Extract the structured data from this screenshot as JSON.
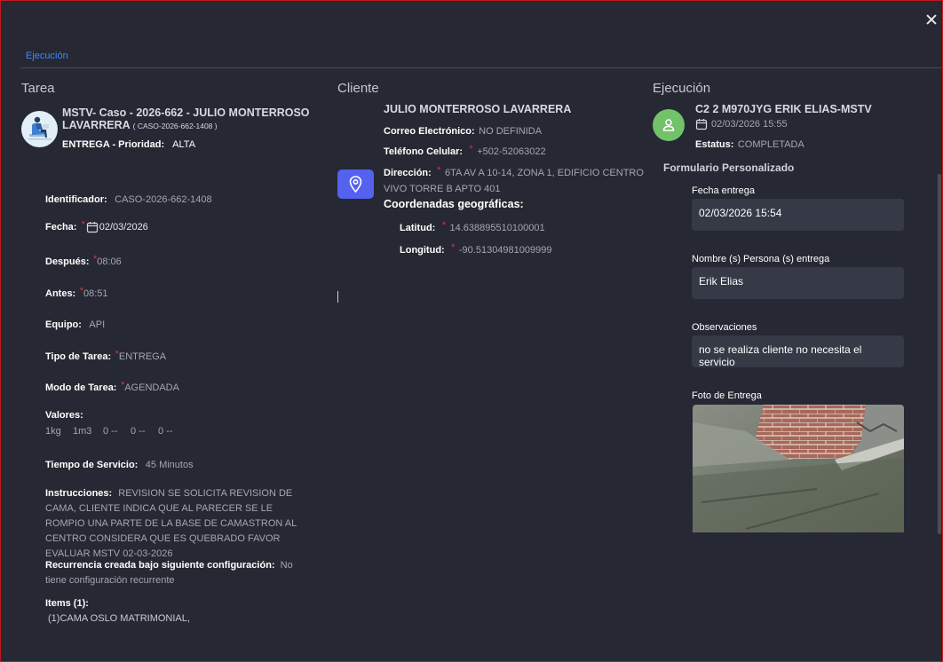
{
  "tab": "Ejecución",
  "columns": {
    "tarea": "Tarea",
    "cliente": "Cliente",
    "ejecucion": "Ejecución"
  },
  "tarea": {
    "title": "MSTV- Caso - 2026-662 - JULIO MONTERROSO LAVARRERA",
    "code": "( CASO-2026-662-1408 )",
    "subtitle_type": "ENTREGA",
    "subtitle_prioridad_label": "- Prioridad:",
    "subtitle_prioridad": "ALTA",
    "identificador_label": "Identificador:",
    "identificador": "CASO-2026-662-1408",
    "fecha_label": "Fecha:",
    "fecha": "02/03/2026",
    "despues_label": "Después:",
    "despues": "08:06",
    "antes_label": "Antes:",
    "antes": "08:51",
    "equipo_label": "Equipo:",
    "equipo": "API",
    "tipo_label": "Tipo de Tarea:",
    "tipo": "ENTREGA",
    "modo_label": "Modo de Tarea:",
    "modo": "AGENDADA",
    "valores_label": "Valores:",
    "valores": [
      "1kg",
      "1m3",
      "0 --",
      "0 --",
      "0 --"
    ],
    "tiempo_label": "Tiempo de Servicio:",
    "tiempo": "45 Minutos",
    "instrucciones_label": "Instrucciones:",
    "instrucciones": "REVISION SE SOLICITA REVISION DE CAMA, CLIENTE INDICA QUE AL PARECER SE LE ROMPIO UNA PARTE DE LA BASE DE CAMASTRON AL CENTRO CONSIDERA QUE ES QUEBRADO FAVOR EVALUAR MSTV 02-03-2026",
    "recurrencia_label": "Recurrencia creada bajo siguiente configuración:",
    "recurrencia": "No tiene configuración recurrente",
    "items_label": "Items (1):",
    "items": "(1)CAMA OSLO MATRIMONIAL,"
  },
  "cliente": {
    "name": "JULIO MONTERROSO LAVARRERA",
    "correo_label": "Correo Electrónico:",
    "correo": "NO DEFINIDA",
    "telefono_label": "Teléfono Celular:",
    "telefono": "+502-52063022",
    "direccion_label": "Dirección:",
    "direccion_1": "6TA AV A 10-14, ZONA 1, EDIFICIO CENTRO",
    "direccion_2": "VIVO TORRE B APTO 401",
    "coords_label": "Coordenadas geográficas:",
    "latitud_label": "Latitud:",
    "latitud": "14.638895510100001",
    "longitud_label": "Longitud:",
    "longitud": "-90.51304981009999"
  },
  "ejecucion": {
    "name": "C2 2 M970JYG ERIK ELIAS-MSTV",
    "datetime": "02/03/2026 15:55",
    "estatus_label": "Estatus:",
    "estatus": "COMPLETADA",
    "form_title": "Formulario Personalizado",
    "fields": [
      {
        "label": "Fecha entrega",
        "value": "02/03/2026 15:54"
      },
      {
        "label": "Nombre (s) Persona (s) entrega",
        "value": "Erik Elias"
      },
      {
        "label": "Observaciones",
        "value": "no se realiza cliente no necesita el servicio"
      }
    ],
    "photo_label": "Foto de Entrega"
  },
  "required_mark": "*",
  "colors": {
    "background": "#262833",
    "accent": "#3d8bff",
    "pin": "#5561ef",
    "avatar_green": "#72c26a",
    "required": "#e0333a"
  }
}
